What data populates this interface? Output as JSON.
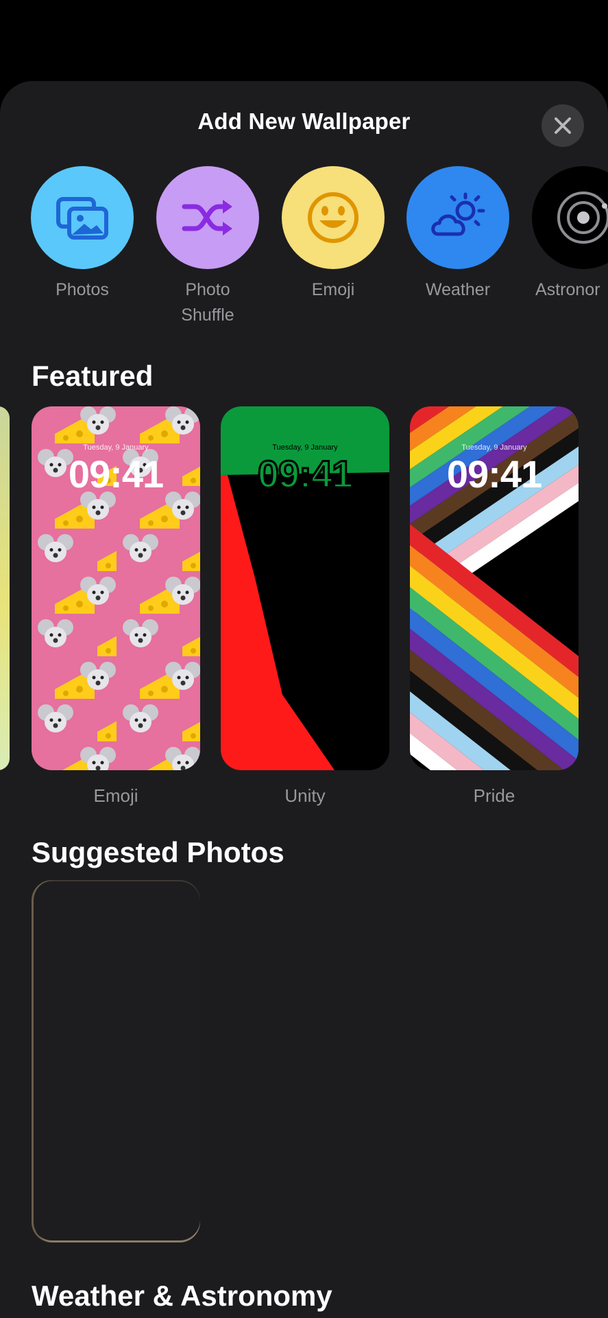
{
  "sheet": {
    "title": "Add New Wallpaper"
  },
  "categories": [
    {
      "label": "Photos",
      "icon": "photos-icon",
      "color": "#5ac8fa"
    },
    {
      "label": "Photo\nShuffle",
      "icon": "shuffle-icon",
      "color": "#c79cf5"
    },
    {
      "label": "Emoji",
      "icon": "emoji-icon",
      "color": "#f7df7a"
    },
    {
      "label": "Weather",
      "icon": "weather-icon",
      "color": "#2e88f0"
    },
    {
      "label": "Astronor",
      "icon": "astronomy-icon",
      "color": "#000000"
    }
  ],
  "sections": {
    "featured": "Featured",
    "suggested": "Suggested Photos",
    "weather_astronomy": "Weather & Astronomy"
  },
  "featured": [
    {
      "label": "Emoji",
      "date": "Tuesday, 9 January",
      "time": "09:41"
    },
    {
      "label": "Unity",
      "date": "Tuesday, 9 January",
      "time": "09:41"
    },
    {
      "label": "Pride",
      "date": "Tuesday, 9 January",
      "time": "09:41"
    }
  ]
}
